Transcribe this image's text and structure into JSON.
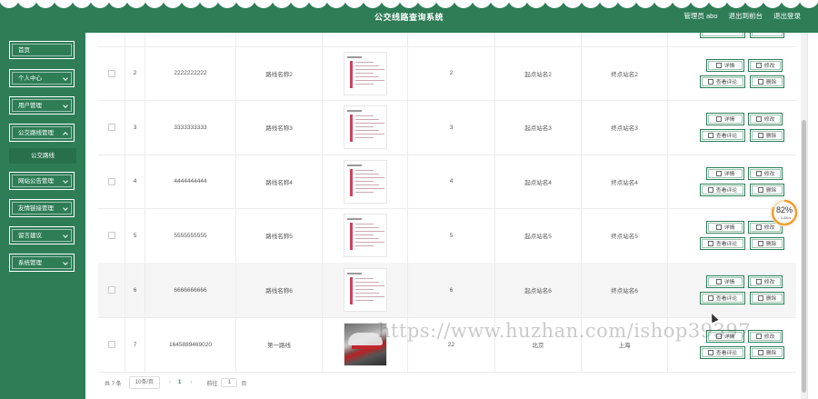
{
  "header": {
    "title": "公交线路查询系统",
    "admin_label": "管理员 abo",
    "back_label": "退出到前台",
    "logout_label": "退出登录",
    "color": "#2e7d57"
  },
  "sidebar": {
    "items": [
      {
        "label": "首页"
      },
      {
        "label": "个人中心"
      },
      {
        "label": "用户管理"
      },
      {
        "label": "公交路线管理"
      },
      {
        "label": "网站公告管理"
      },
      {
        "label": "友情链接管理"
      },
      {
        "label": "留言建议"
      },
      {
        "label": "系统管理"
      }
    ],
    "submenu": {
      "label": "公交路线"
    }
  },
  "table": {
    "rows": [
      {
        "index": "2",
        "number": "2222222222",
        "name": "路线名称2",
        "count": "2",
        "start": "起点站名2",
        "end": "终点站名2"
      },
      {
        "index": "3",
        "number": "3333333333",
        "name": "路线名称3",
        "count": "3",
        "start": "起点站名3",
        "end": "终点站名3"
      },
      {
        "index": "4",
        "number": "4444444444",
        "name": "路线名称4",
        "count": "4",
        "start": "起点站名4",
        "end": "终点站名4"
      },
      {
        "index": "5",
        "number": "5555555555",
        "name": "路线名称5",
        "count": "5",
        "start": "起点站名5",
        "end": "终点站名5"
      },
      {
        "index": "6",
        "number": "6666666666",
        "name": "路线名称6",
        "count": "6",
        "start": "起点站名6",
        "end": "终点站名6"
      },
      {
        "index": "7",
        "number": "1645889469020",
        "name": "第一路线",
        "count": "22",
        "start": "北京",
        "end": "上海"
      }
    ],
    "actions": {
      "detail": "详情",
      "edit": "修改",
      "comment": "查看评论",
      "delete": "删除"
    }
  },
  "pager": {
    "total": "共 7 条",
    "page_size": "10条/页",
    "prev": "‹",
    "current": "1",
    "next": "›",
    "goto": "前往",
    "jump_value": "1",
    "page_suffix": "页"
  },
  "progress": {
    "percent": "82%",
    "speed": "↑ 0.8K/s",
    "value": 0.82
  },
  "watermark": "https://www.huzhan.com/ishop39397"
}
